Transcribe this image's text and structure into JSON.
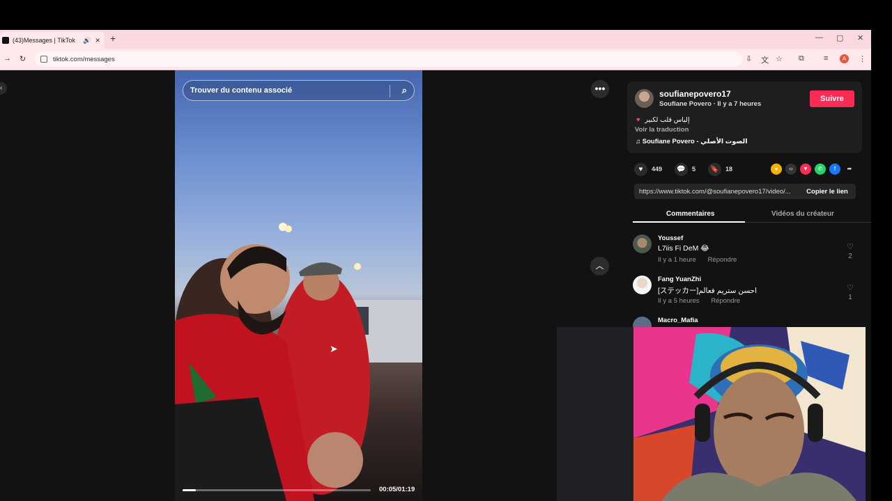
{
  "browser": {
    "tab_title": "(43)Messages | TikTok",
    "new_tab": "+",
    "url": "tiktok.com/messages",
    "profile_initial": "A"
  },
  "video": {
    "search_placeholder": "Trouver du contenu associé",
    "time": "00:05/01:19",
    "progress": 0.07
  },
  "creator": {
    "username": "soufianepovero17",
    "subtitle": "Soufiane Povero · Il y a 7 heures",
    "follow_label": "Suivre",
    "description": "إلياس قلب لكبير",
    "see_translation": "Voir la traduction",
    "music": "Soufiane Povero - الصوت الأصلي"
  },
  "stats": {
    "likes": "449",
    "comments": "5",
    "saves": "18"
  },
  "link": {
    "url": "https://www.tiktok.com/@soufianepovero17/video/...",
    "copy_label": "Copier le lien"
  },
  "tabs": {
    "comments": "Commentaires",
    "creator_videos": "Vidéos du créateur"
  },
  "comments": [
    {
      "user": "Youssef",
      "text": "L7iis Fi DeM 😂",
      "time": "Il y a 1 heure",
      "reply": "Répondre",
      "likes": "2"
    },
    {
      "user": "Fang YuanZhi",
      "text": "[ステッカー]احسن ستريم فعالم",
      "time": "Il y a 5 heures",
      "reply": "Répondre",
      "likes": "1"
    },
    {
      "user": "Macro_Mafia"
    }
  ],
  "colors": {
    "follow": "#fe2c55",
    "tabbar": "#fbd9e0",
    "page_bg": "#121212"
  }
}
